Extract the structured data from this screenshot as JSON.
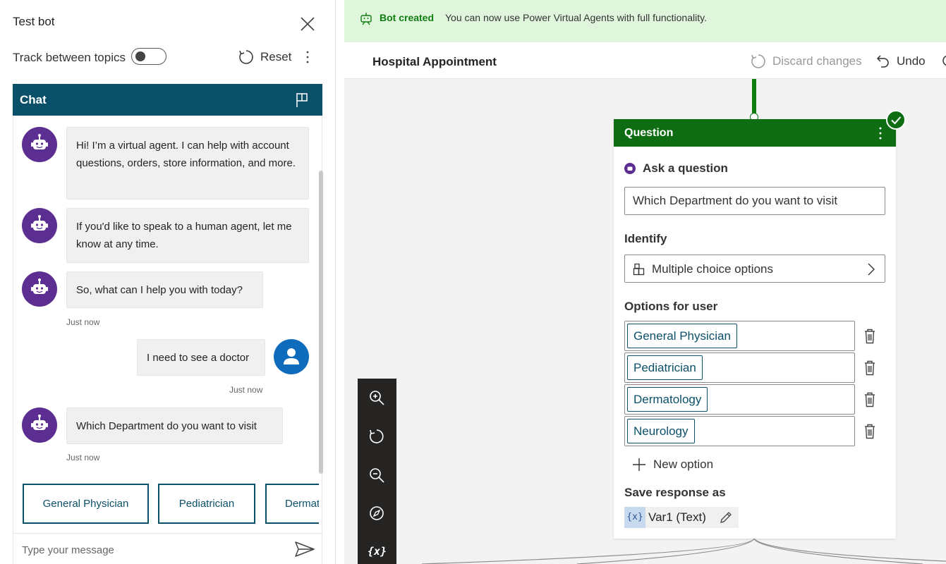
{
  "test_panel": {
    "title": "Test bot",
    "track_label": "Track between topics",
    "track_enabled": false,
    "reset_label": "Reset"
  },
  "chat": {
    "title": "Chat",
    "messages": [
      {
        "from": "bot",
        "text": "Hi! I’m a virtual agent. I can help with account questions, orders, store information, and more."
      },
      {
        "from": "bot",
        "text": "If you'd like to speak to a human agent, let me know at any time."
      },
      {
        "from": "bot",
        "text": "So, what can I help you with today?",
        "time": "Just now"
      },
      {
        "from": "user",
        "text": "I need to see a doctor",
        "time": "Just now"
      },
      {
        "from": "bot",
        "text": "Which Department do you want to visit",
        "time": "Just now"
      }
    ],
    "choices": [
      "General Physician",
      "Pediatrician",
      "Dermatology"
    ],
    "input_placeholder": "Type your message"
  },
  "banner": {
    "strong": "Bot created",
    "text": "You can now use Power Virtual Agents with full functionality."
  },
  "toolbar": {
    "topic_title": "Hospital Appointment",
    "discard_label": "Discard changes",
    "undo_label": "Undo"
  },
  "question_node": {
    "title": "Question",
    "ask_label": "Ask a question",
    "question_text": "Which Department do you want to visit",
    "identify_label": "Identify",
    "identify_value": "Multiple choice options",
    "options_label": "Options for user",
    "options": [
      "General Physician",
      "Pediatrician",
      "Dermatology",
      "Neurology"
    ],
    "new_option_label": "New option",
    "save_label": "Save response as",
    "variable_badge": "{x}",
    "variable_label": "Var1 (Text)"
  },
  "zoom_toolbar": {
    "variables_glyph": "{x}"
  },
  "colors": {
    "chat_header": "#0b5069",
    "bot_avatar": "#5c2e91",
    "user_avatar": "#0f6cbd",
    "node_header": "#0e6d12",
    "banner_bg": "#dff6dd"
  }
}
